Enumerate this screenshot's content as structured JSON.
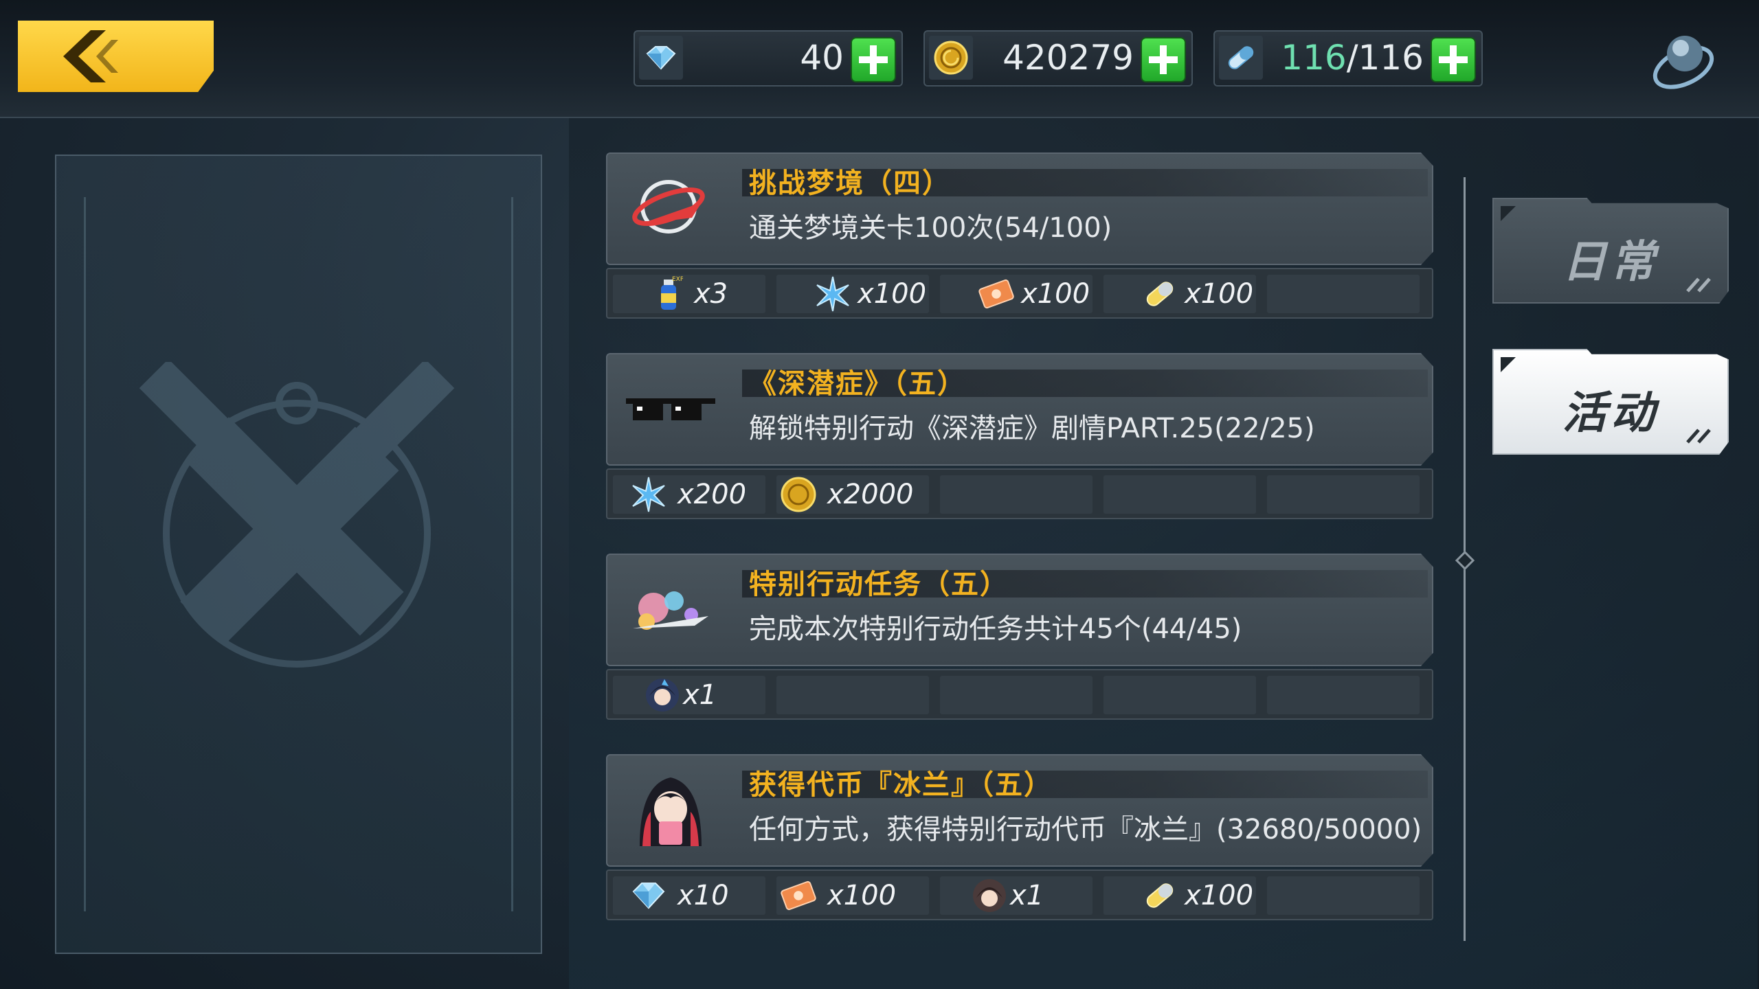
{
  "header": {
    "back_icon": "back-arrow-icon",
    "resources": [
      {
        "icon": "crystal-icon",
        "value": "40"
      },
      {
        "icon": "coin-icon",
        "value": "420279"
      },
      {
        "icon": "stamina-icon",
        "current": "116",
        "sep": "/",
        "max": "116"
      }
    ],
    "orb_icon": "orb-icon"
  },
  "tabs": [
    {
      "label": "日常",
      "active": false
    },
    {
      "label": "活动",
      "active": true
    }
  ],
  "tasks": [
    {
      "title": "挑战梦境（四）",
      "desc": "通关梦境关卡100次(54/100)",
      "icon": "dream-challenge-icon",
      "rewards": [
        {
          "icon": "exp-potion-icon",
          "qty": "x3"
        },
        {
          "icon": "blue-crystal-shard-icon",
          "qty": "x100"
        },
        {
          "icon": "ticket-icon",
          "qty": "x100"
        },
        {
          "icon": "capsule-icon",
          "qty": "x100"
        }
      ]
    },
    {
      "title": "《深潜症》（五）",
      "desc": "解锁特别行动《深潜症》剧情PART.25(22/25)",
      "icon": "pixel-sunglasses-icon",
      "rewards": [
        {
          "icon": "blue-crystal-shard-icon",
          "qty": "x200"
        },
        {
          "icon": "coin-icon",
          "qty": "x2000"
        }
      ]
    },
    {
      "title": "特别行动任务（五）",
      "desc": "完成本次特别行动任务共计45个(44/45)",
      "icon": "bubbles-splash-icon",
      "rewards": [
        {
          "icon": "character-avatar-icon",
          "qty": "x1"
        }
      ]
    },
    {
      "title": "获得代币『冰兰』（五）",
      "desc": "任何方式，获得特别行动代币『冰兰』(32680/50000)",
      "icon": "red-haired-girl-icon",
      "rewards": [
        {
          "icon": "crystal-icon",
          "qty": "x10"
        },
        {
          "icon": "ticket-icon",
          "qty": "x100"
        },
        {
          "icon": "character-avatar-icon",
          "qty": "x1"
        },
        {
          "icon": "capsule-icon",
          "qty": "x100"
        }
      ]
    }
  ],
  "colors": {
    "title_gold": "#f3b220",
    "back_yellow": "#f2b51a",
    "plus_green": "#21a82a"
  }
}
